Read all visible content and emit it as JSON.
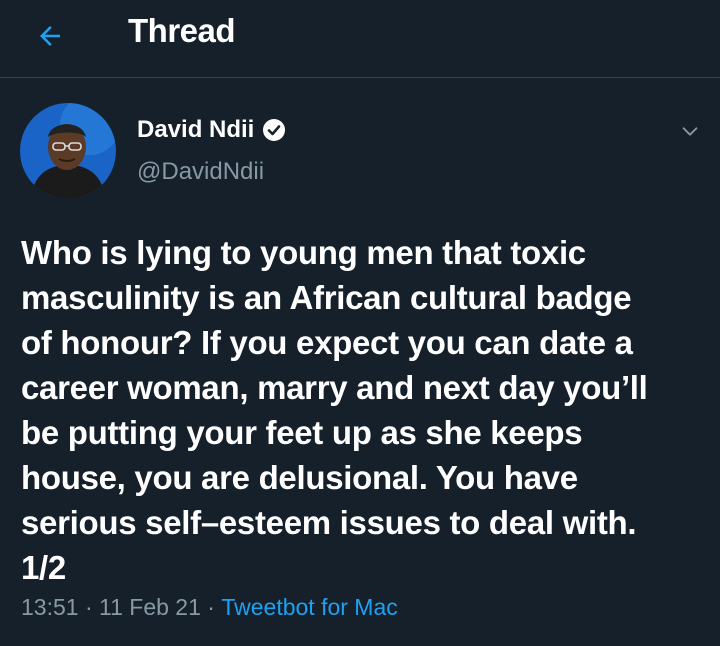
{
  "header": {
    "back_icon": "arrow-left-icon",
    "title": "Thread"
  },
  "tweet": {
    "author": {
      "name": "David Ndii",
      "handle": "@DavidNdii",
      "verified": true
    },
    "text": "Who is lying to young men that toxic\nmasculinity is an African cultural badge\nof honour? If you expect you can date a\ncareer woman, marry and next day you’ll\nbe putting your feet up as she keeps\nhouse, you are delusional. You have\nserious self–esteem issues to deal with.\n1/2",
    "time": "13:51",
    "date": "11 Feb 21",
    "separator": " · ",
    "source": "Tweetbot for Mac"
  },
  "colors": {
    "background": "#15202b",
    "divider": "#38444d",
    "accent": "#1da1f2",
    "secondary_text": "#8899a6"
  }
}
